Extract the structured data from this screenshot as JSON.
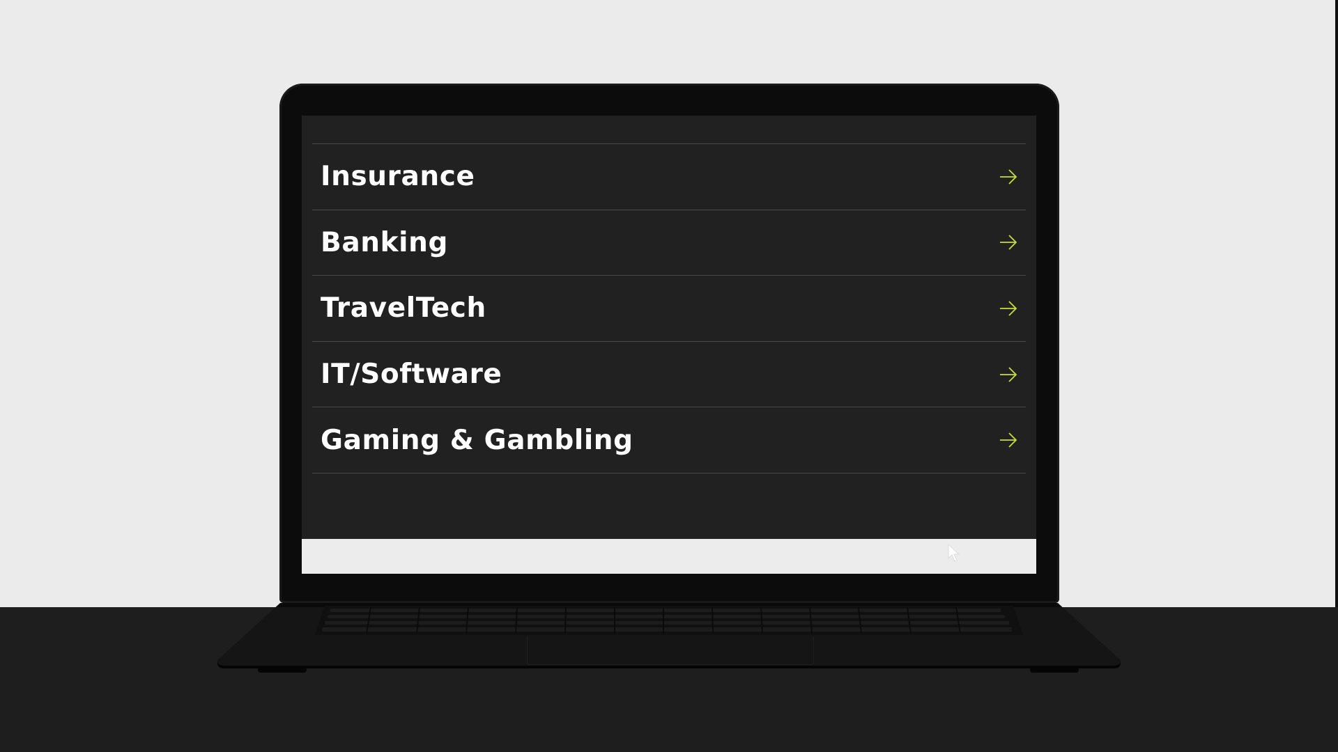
{
  "menu": {
    "items": [
      {
        "label": "Insurance"
      },
      {
        "label": "Banking"
      },
      {
        "label": "TravelTech"
      },
      {
        "label": "IT/Software"
      },
      {
        "label": "Gaming & Gambling"
      }
    ]
  },
  "icons": {
    "item_arrow": "arrow-right-icon",
    "pointer": "cursor-icon"
  },
  "colors": {
    "screen_background": "#212121",
    "divider": "#4a4a4a",
    "label": "#ffffff",
    "arrow_accent": "#c8e02a",
    "bottom_bar": "#ececec"
  }
}
